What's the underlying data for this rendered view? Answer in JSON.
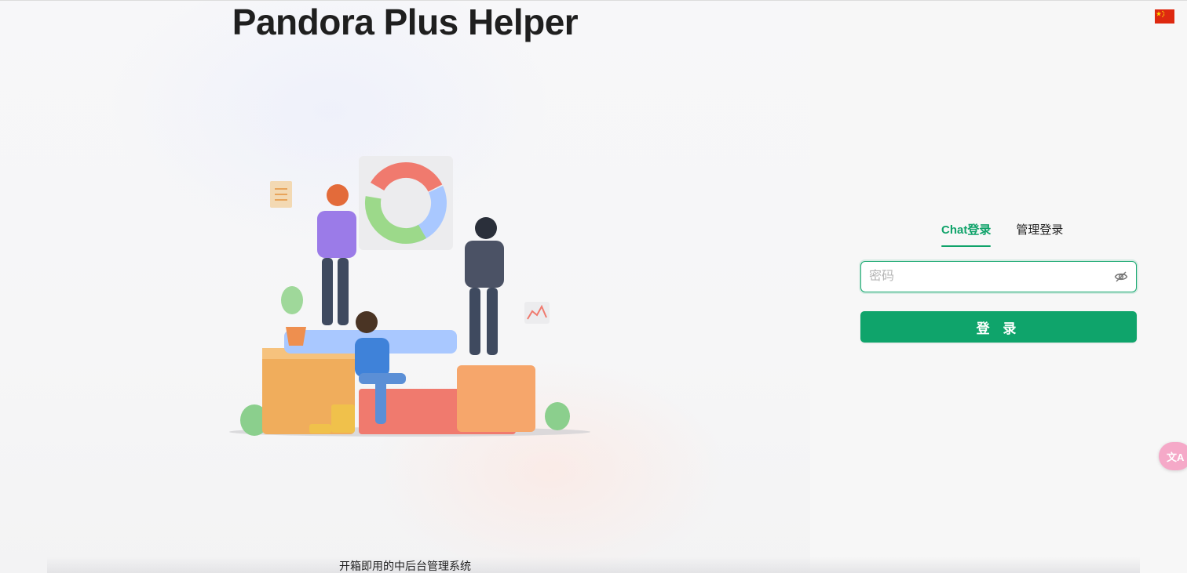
{
  "header": {
    "title": "Pandora Plus Helper",
    "subtitle": "开箱即用的中后台管理系统"
  },
  "language": {
    "current": "zh-CN",
    "flag_icon": "china-flag-icon"
  },
  "login": {
    "tabs": [
      {
        "label": "Chat登录",
        "active": true
      },
      {
        "label": "管理登录",
        "active": false
      }
    ],
    "password": {
      "placeholder": "密码",
      "value": ""
    },
    "submit_label": "登 录"
  },
  "translate_fab": {
    "label": "文A",
    "icon": "translate-icon"
  },
  "colors": {
    "accent": "#0fa46b",
    "title": "#1f1f1f",
    "flag": "#de2910",
    "fab": "#f5a9c8"
  }
}
